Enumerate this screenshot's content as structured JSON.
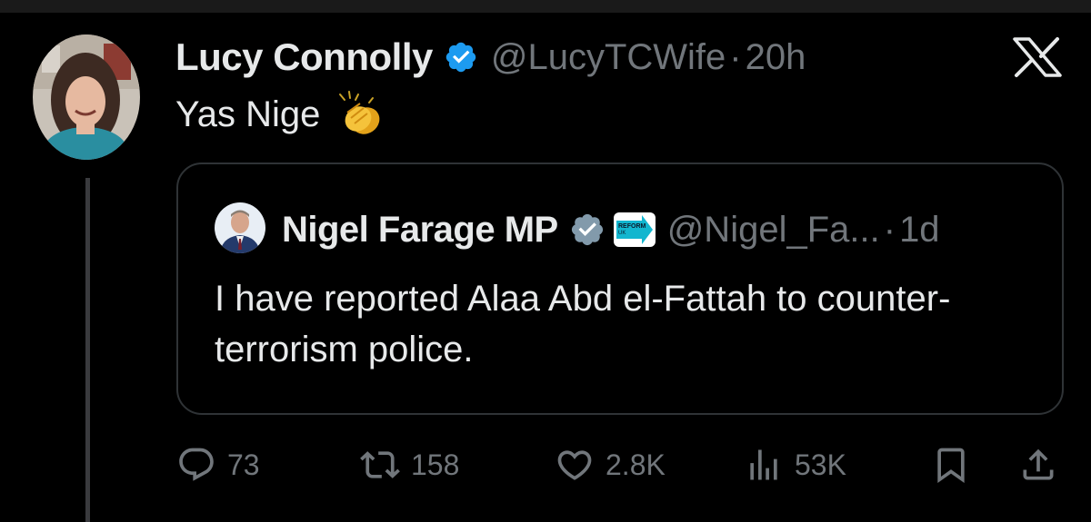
{
  "tweet": {
    "display_name": "Lucy Connolly",
    "handle": "@LucyTCWife",
    "separator": "·",
    "time": "20h",
    "text": "Yas Nige"
  },
  "quoted_tweet": {
    "display_name": "Nigel Farage MP",
    "badge_text_1": "REFORM",
    "badge_text_2": "UK",
    "handle": "@Nigel_Fa...",
    "separator": "·",
    "time": "1d",
    "text": "I have reported Alaa Abd el-Fattah to counter-terrorism police."
  },
  "actions": {
    "replies": "73",
    "reposts": "158",
    "likes": "2.8K",
    "views": "53K"
  },
  "colors": {
    "background": "#000000",
    "text_primary": "#e7e9ea",
    "text_secondary": "#71767b",
    "verified_blue": "#1d9bf0",
    "verified_gray": "#829aab",
    "reform_cyan": "#12b6cf",
    "border": "#2f3336"
  },
  "icons": {
    "close": "x-logo-icon",
    "verified": "verified-badge-icon",
    "emoji": "clapping-hands-emoji",
    "reply": "reply-icon",
    "repost": "repost-icon",
    "like": "heart-icon",
    "views": "views-icon",
    "bookmark": "bookmark-icon",
    "share": "share-icon"
  }
}
